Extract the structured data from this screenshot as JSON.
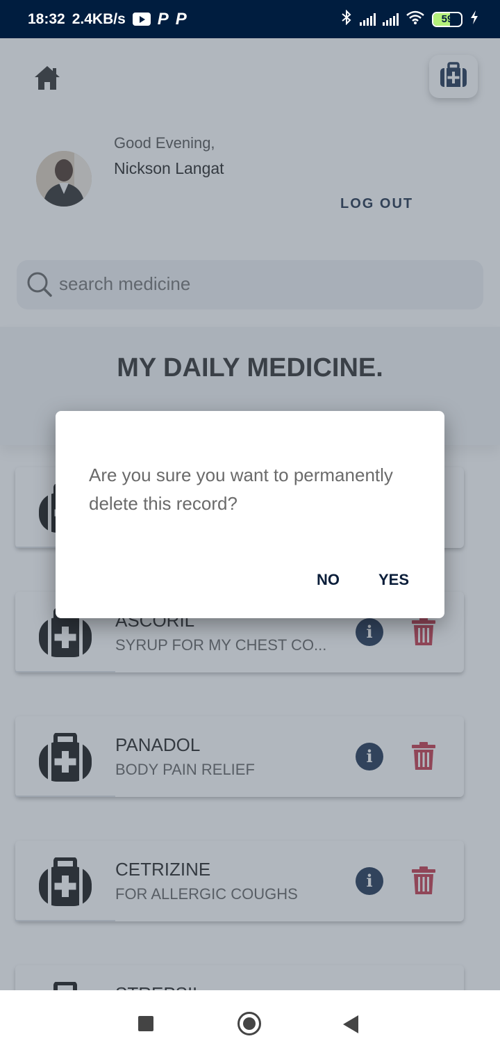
{
  "status_bar": {
    "time": "18:32",
    "speed": "2.4KB/s",
    "p1": "P",
    "p2": "P",
    "battery": "59"
  },
  "profile": {
    "greeting": "Good Evening,",
    "name": "Nickson Langat",
    "logout_label": "LOG OUT"
  },
  "search": {
    "placeholder": "search medicine"
  },
  "section": {
    "title": "MY DAILY MEDICINE."
  },
  "medicines": [
    {
      "name": "",
      "desc": ""
    },
    {
      "name": "ASCORIL",
      "desc": "SYRUP FOR MY CHEST CO..."
    },
    {
      "name": "PANADOL",
      "desc": "BODY PAIN RELIEF"
    },
    {
      "name": "CETRIZINE",
      "desc": "FOR ALLERGIC COUGHS"
    },
    {
      "name": "STREPSIL",
      "desc": ""
    }
  ],
  "dialog": {
    "message": "Are you sure you want to permanently delete this record?",
    "no_label": "NO",
    "yes_label": "YES"
  },
  "colors": {
    "navy": "#001d3f",
    "delete_red": "#c0283c",
    "info_navy": "#0a2144"
  },
  "icons": {
    "home": "home-icon",
    "kit": "medical-kit-icon",
    "search": "search-icon",
    "info": "info-icon",
    "trash": "trash-icon"
  }
}
